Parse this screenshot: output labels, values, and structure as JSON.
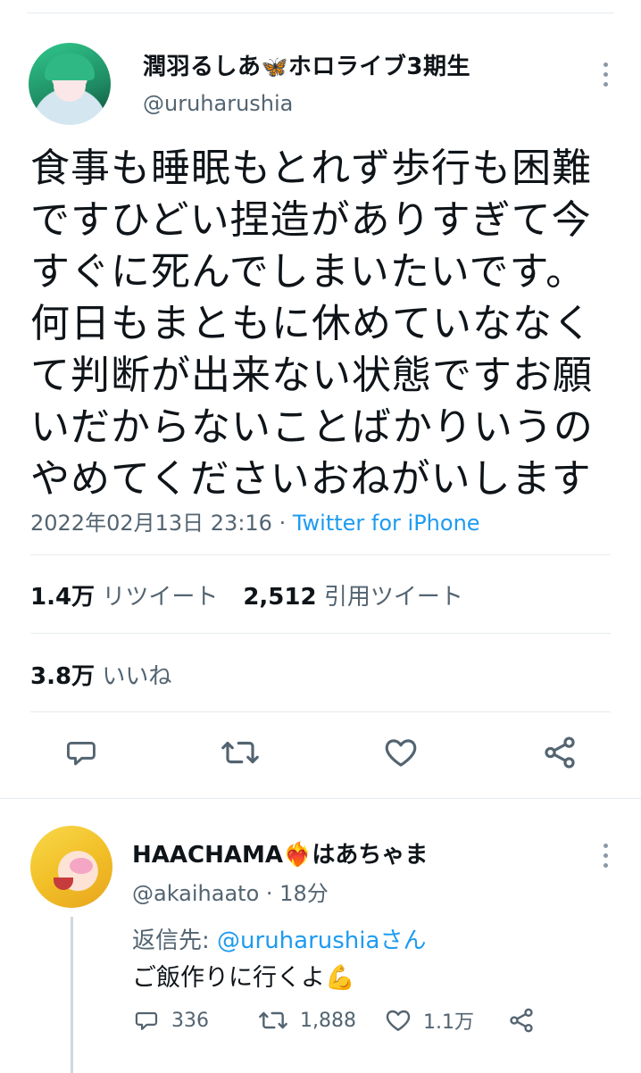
{
  "tweet": {
    "display_name": "潤羽るしあ",
    "name_emoji": "🦋",
    "name_suffix": "ホロライブ3期生",
    "handle": "@uruharushia",
    "text": "食事も睡眠もとれず歩行も困難ですひどい捏造がありすぎて今すぐに死んでしまいたいです。何日もまともに休めていななくて判断が出来ない状態ですお願いだからないことばかりいうのやめてくださいおねがいします",
    "timestamp": "2022年02月13日 23:16",
    "separator": " · ",
    "source": "Twitter for iPhone",
    "retweets_count": "1.4万",
    "retweets_label": "リツイート",
    "quotes_count": "2,512",
    "quotes_label": "引用ツイート",
    "likes_count": "3.8万",
    "likes_label": "いいね"
  },
  "reply": {
    "display_name": "HAACHAMA",
    "name_emoji": "❤️‍🔥",
    "name_suffix": "はあちゃま",
    "handle": "@akaihaato",
    "time": " · 18分",
    "replying_prefix": "返信先: ",
    "replying_mention": "@uruharushia",
    "replying_suffix": "さん",
    "text": "ご飯作りに行くよ",
    "text_emoji": "💪",
    "reply_count": "336",
    "retweet_count": "1,888",
    "like_count": "1.1万"
  },
  "colors": {
    "accent": "#1d9bf0",
    "secondary_text": "#536471",
    "primary_text": "#0f1419",
    "divider": "#e6ecf0"
  },
  "icons": {
    "more": "more-vertical-icon",
    "reply": "reply-icon",
    "retweet": "retweet-icon",
    "like": "heart-icon",
    "share": "share-icon"
  }
}
